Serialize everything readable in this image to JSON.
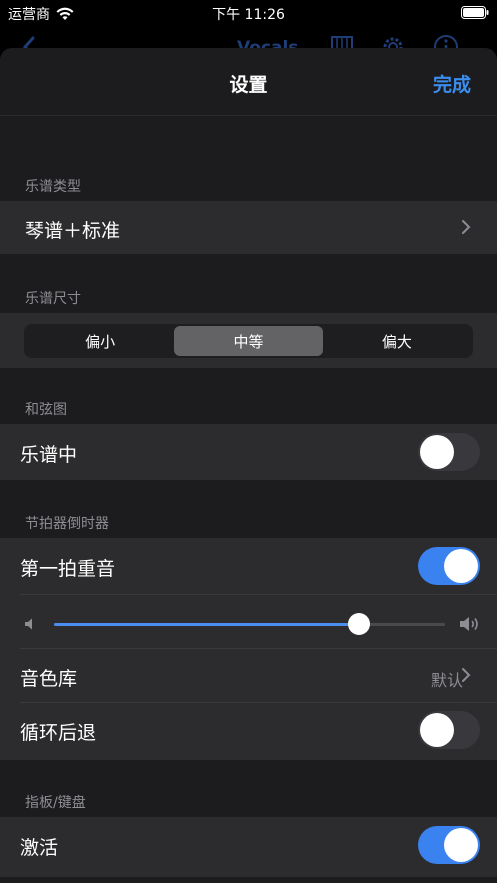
{
  "status_bar": {
    "carrier": "运营商",
    "time": "下午 11:26"
  },
  "background_nav": {
    "title": "Vocals"
  },
  "sheet": {
    "title": "设置",
    "done_label": "完成"
  },
  "sections": {
    "score_type": {
      "header": "乐谱类型",
      "value": "琴谱＋标准"
    },
    "score_size": {
      "header": "乐谱尺寸",
      "options": [
        "偏小",
        "中等",
        "偏大"
      ],
      "selected": "中等"
    },
    "chord_diagram": {
      "header": "和弦图",
      "in_score_label": "乐谱中",
      "in_score_on": false
    },
    "metronome": {
      "header": "节拍器倒时器",
      "accent_label": "第一拍重音",
      "accent_on": true,
      "volume": 0.78,
      "sound_label": "音色库",
      "sound_value": "默认",
      "loop_label": "循环后退",
      "loop_on": false
    },
    "fretboard": {
      "header": "指板/键盘",
      "activate_label": "激活",
      "activate_on": true
    }
  },
  "colors": {
    "accent": "#3a8ef0",
    "toggle_on": "#3a82f0",
    "cell_bg": "#2c2c2e",
    "sheet_bg": "#1c1c1e"
  }
}
